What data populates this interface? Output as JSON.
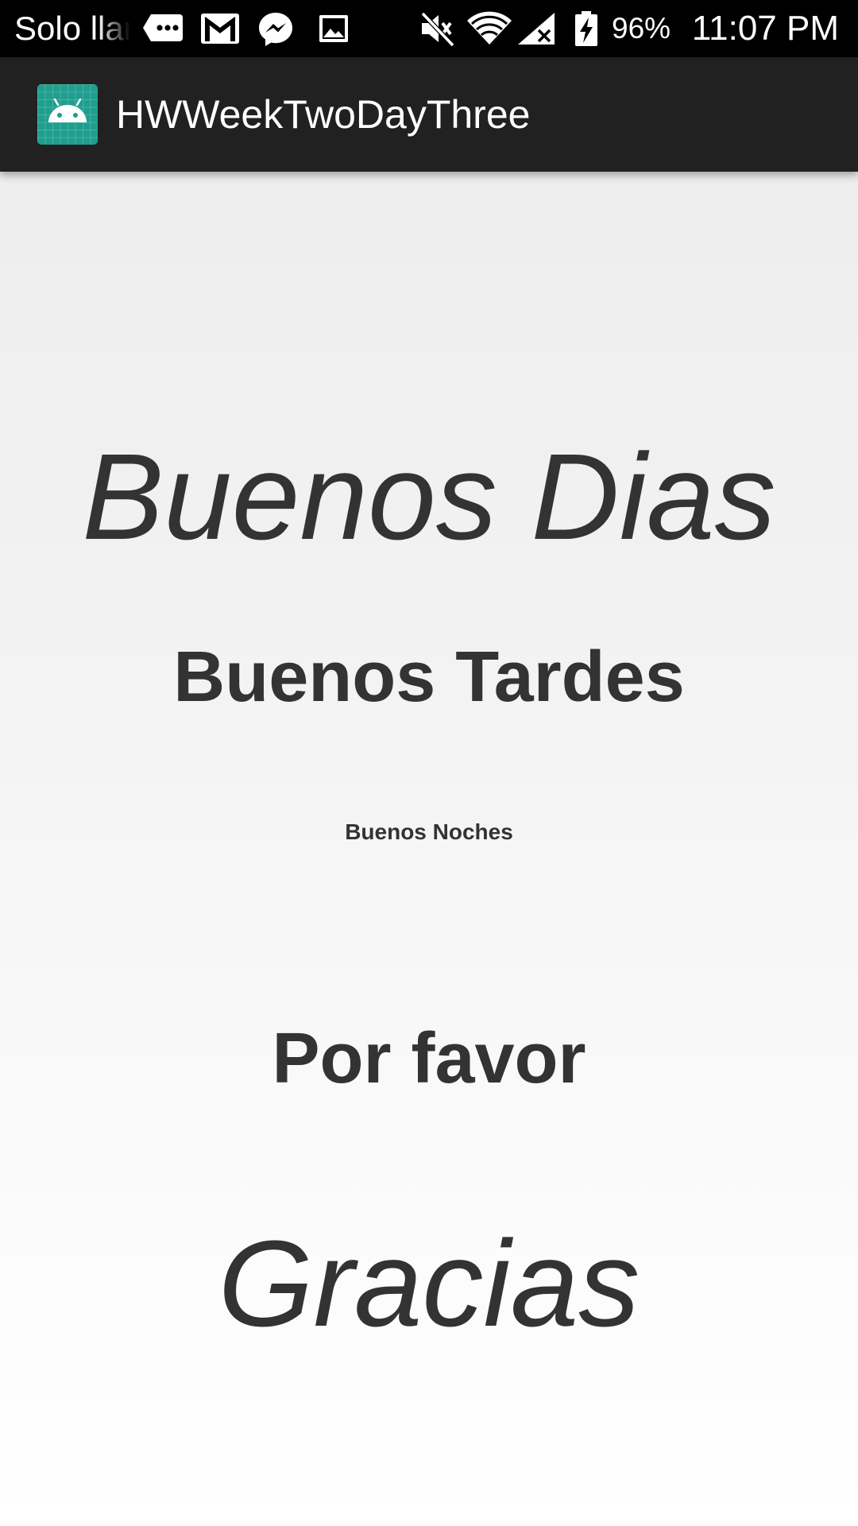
{
  "status_bar": {
    "carrier": "Solo llamadas",
    "battery_percent": "96%",
    "time": "11:07 PM",
    "icons": {
      "left": [
        "sms-icon",
        "gmail-icon",
        "messenger-icon",
        "gallery-icon"
      ],
      "right": [
        "mute-icon",
        "wifi-icon",
        "signal-no-service-icon",
        "battery-charging-icon"
      ]
    }
  },
  "app_bar": {
    "title": "HWWeekTwoDayThree",
    "icon": "android-launcher-icon",
    "background_color": "#212121",
    "icon_color": "#1f9e8e"
  },
  "greetings": {
    "dias": "Buenos Dias",
    "tardes": "Buenos Tardes",
    "noches": "Buenos Noches",
    "favor": "Por favor",
    "gracias": "Gracias"
  },
  "colors": {
    "text": "#333333",
    "status_bar": "#000000"
  }
}
